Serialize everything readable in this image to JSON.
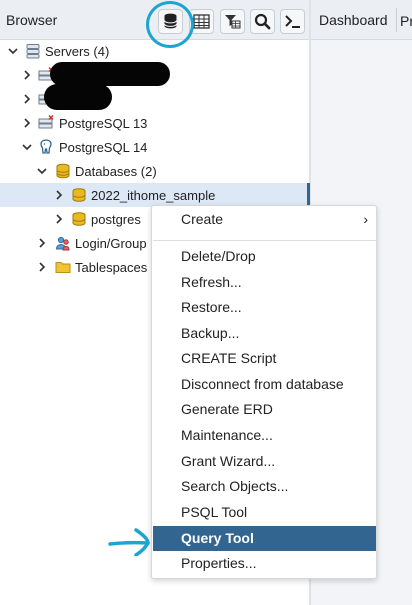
{
  "panel": {
    "title": "Browser"
  },
  "toolbar": {
    "buttons": [
      {
        "name": "object-explorer-icon"
      },
      {
        "name": "table-grid-icon"
      },
      {
        "name": "filter-table-icon"
      },
      {
        "name": "search-icon"
      },
      {
        "name": "terminal-icon"
      }
    ]
  },
  "tabs": {
    "dashboard": "Dashboard",
    "next_cut": "Pr"
  },
  "tree": {
    "servers": "Servers (4)",
    "pg13": "PostgreSQL 13",
    "pg14": "PostgreSQL 14",
    "databases": "Databases (2)",
    "db_sample": "2022_ithome_sample",
    "db_postgres": "postgres",
    "login_group": "Login/Group",
    "tablespaces": "Tablespaces"
  },
  "context_menu": {
    "create": "Create",
    "items": [
      "Delete/Drop",
      "Refresh...",
      "Restore...",
      "Backup...",
      "CREATE Script",
      "Disconnect from database",
      "Generate ERD",
      "Maintenance...",
      "Grant Wizard...",
      "Search Objects...",
      "PSQL Tool",
      "Query Tool",
      "Properties..."
    ],
    "active_item": "Query Tool"
  },
  "colors": {
    "accent": "#326690",
    "annotation": "#1da4cf",
    "header_bg": "#ebeef3",
    "selection_bg": "#dce8f5"
  }
}
